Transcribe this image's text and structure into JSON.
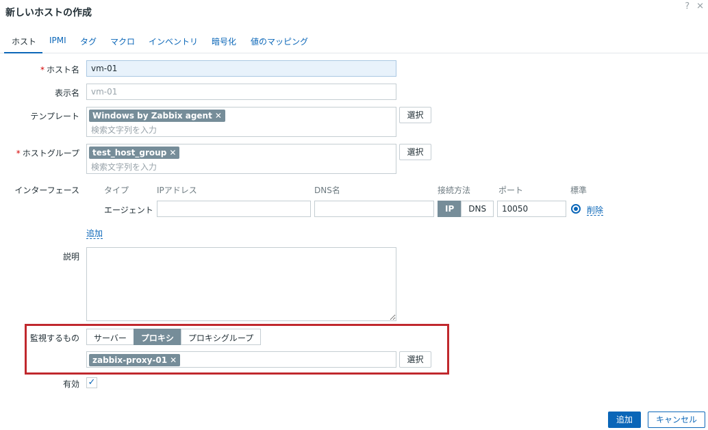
{
  "dialog": {
    "title": "新しいホストの作成",
    "help_icon": "?",
    "close_icon": "✕"
  },
  "tabs": [
    {
      "label": "ホスト",
      "active": true
    },
    {
      "label": "IPMI"
    },
    {
      "label": "タグ"
    },
    {
      "label": "マクロ"
    },
    {
      "label": "インベントリ"
    },
    {
      "label": "暗号化"
    },
    {
      "label": "値のマッピング"
    }
  ],
  "form": {
    "required_mark": "*",
    "host_name": {
      "label": "ホスト名",
      "value": "vm-01"
    },
    "visible_name": {
      "label": "表示名",
      "placeholder": "vm-01"
    },
    "templates": {
      "label": "テンプレート",
      "tags": [
        "Windows by Zabbix agent"
      ],
      "placeholder": "検索文字列を入力",
      "select_label": "選択"
    },
    "host_groups": {
      "label": "ホストグループ",
      "tags": [
        "test_host_group"
      ],
      "placeholder": "検索文字列を入力",
      "select_label": "選択"
    },
    "interfaces": {
      "label": "インターフェース",
      "columns": {
        "type": "タイプ",
        "ip": "IPアドレス",
        "dns": "DNS名",
        "connect": "接続方法",
        "port": "ポート",
        "default": "標準"
      },
      "rows": [
        {
          "type": "エージェント",
          "ip": "",
          "dns": "",
          "connect_options": [
            "IP",
            "DNS"
          ],
          "connect_selected": "IP",
          "port": "10050",
          "remove_label": "削除"
        }
      ],
      "add_label": "追加"
    },
    "description": {
      "label": "説明",
      "value": ""
    },
    "monitored_by": {
      "label": "監視するもの",
      "options": [
        "サーバー",
        "プロキシ",
        "プロキシグループ"
      ],
      "selected": "プロキシ",
      "proxy_tag": "zabbix-proxy-01",
      "select_label": "選択"
    },
    "enabled": {
      "label": "有効",
      "checked": true
    }
  },
  "footer": {
    "add_label": "追加",
    "cancel_label": "キャンセル"
  },
  "colors": {
    "accent": "#0a66b8",
    "tag_bg": "#768d99",
    "highlight_box": "#c0282d"
  }
}
